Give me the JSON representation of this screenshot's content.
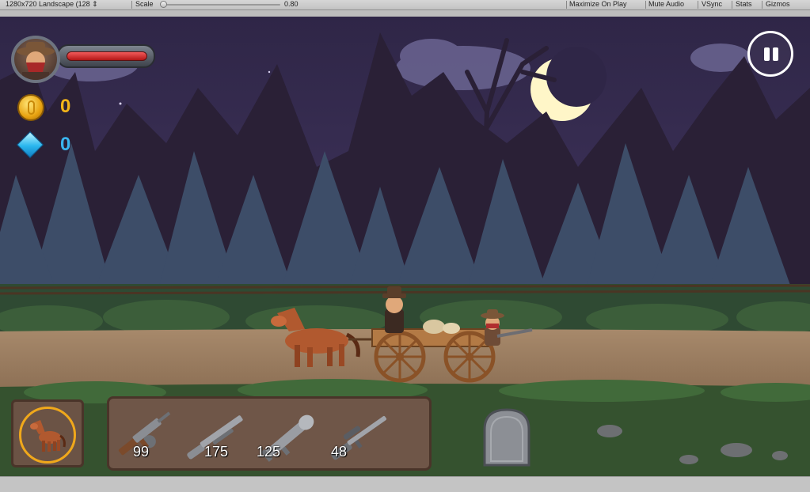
{
  "toolbar": {
    "resolution": "1280x720 Landscape (128",
    "scale_label": "Scale",
    "scale_value": "0.80",
    "maximize_on_play": "Maximize On Play",
    "mute_audio": "Mute Audio",
    "vsync": "VSync",
    "stats": "Stats",
    "gizmos": "Gizmos"
  },
  "hud": {
    "health_fraction": 1.0,
    "coins": "0",
    "gems": "0"
  },
  "weapons": [
    {
      "name": "tommy-gun",
      "ammo": "99"
    },
    {
      "name": "shotgun",
      "ammo": "175"
    },
    {
      "name": "rocket-launcher",
      "ammo": "125"
    },
    {
      "name": "sniper-rifle",
      "ammo": "48"
    }
  ],
  "colors": {
    "sky": "#3a3153",
    "coin": "#f2b419",
    "gem": "#3ab6f0",
    "health": "#d52525",
    "panel": "#6f5648"
  }
}
